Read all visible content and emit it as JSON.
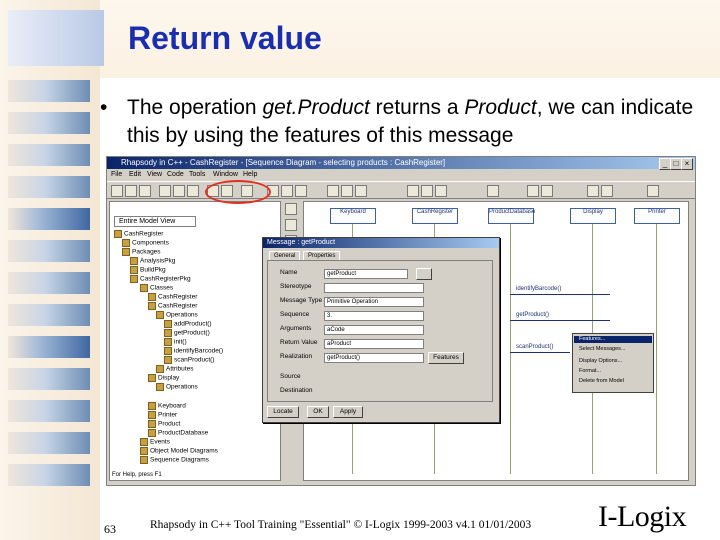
{
  "slide": {
    "title": "Return value",
    "bullet_marker": "•",
    "bullet_parts": [
      "The operation ",
      "get.Product",
      " returns a ",
      "Product",
      ", we can indicate this by using the features of this message"
    ],
    "page_number": "63",
    "footer": "Rhapsody in C++ Tool Training \"Essential\" © I-Logix 1999-2003 v4.1 01/01/2003",
    "logo": "I-Logix",
    "colors": {
      "title": "#1a2fb0",
      "accent_tile": "#3f67a3",
      "annotation_circle": "#e03020"
    }
  },
  "screenshot": {
    "window_title": "Rhapsody in C++ - CashRegister - [Sequence Diagram - selecting products : CashRegister]",
    "menu": [
      "File",
      "Edit",
      "View",
      "Code",
      "Tools",
      "Window",
      "Help"
    ],
    "browser": {
      "view_selector": "Entire Model View",
      "tree": [
        "CashRegister",
        "Components",
        "Packages",
        "AnalysisPkg",
        "BuildPkg",
        "CashRegisterPkg",
        "Classes",
        "CashRegister",
        "CashRegister",
        "Operations",
        "addProduct()",
        "getProduct()",
        "init()",
        "identifyBarcode()",
        "scanProduct()",
        "Attributes",
        "Display",
        "Operations",
        "Keyboard",
        "Printer",
        "Product",
        "ProductDatabase",
        "Events",
        "Object Model Diagrams",
        "Sequence Diagrams"
      ],
      "status": "For Help, press F1"
    },
    "diagram": {
      "lifelines": [
        "Keyboard",
        "CashRegister",
        "ProductDatabase",
        "Display",
        "Printer"
      ],
      "messages": [
        "getProduct()",
        "identifyBarcode()",
        "scanProduct()"
      ]
    },
    "dialog": {
      "title": "Message : getProduct",
      "tabs": [
        "General",
        "Properties"
      ],
      "fields": [
        {
          "label": "Name",
          "value": "getProduct"
        },
        {
          "label": "Stereotype",
          "value": ""
        },
        {
          "label": "Message Type",
          "value": "Primitive Operation"
        },
        {
          "label": "Sequence",
          "value": "3."
        },
        {
          "label": "Arguments",
          "value": "aCode"
        },
        {
          "label": "Return Value",
          "value": "aProduct"
        },
        {
          "label": "Realization",
          "value": "getProduct()"
        }
      ],
      "buttons": [
        "Locate",
        "OK",
        "Apply"
      ],
      "features_button": "Features",
      "source": "Source",
      "destination": "Destination"
    },
    "popup_menu": [
      "Features...",
      "Select Messages...",
      "Display Options...",
      "Format...",
      "Delete from Model"
    ]
  }
}
